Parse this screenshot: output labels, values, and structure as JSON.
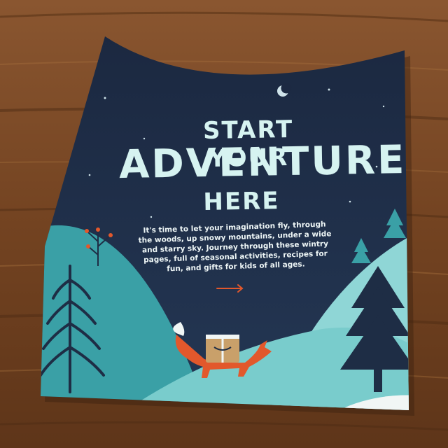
{
  "flyer": {
    "headline_line1": "START YOUR",
    "headline_line2": "ADVENTURE",
    "headline_line3": "HERE",
    "body": "It's time to let your imagination fly, through the woods, up snowy mountains, under a wide and starry sky. Journey through these wintry pages, full of seasonal activities, recipes for fun, and gifts for kids of all ages."
  },
  "colors": {
    "table_wood": "#7a4a26",
    "night_sky": "#1e2d45",
    "hill_teal": "#3aa0a6",
    "hill_light": "#8fd6d6",
    "snow": "#f1f6f5",
    "fox_orange": "#e2582c",
    "headline_mint": "#d6f3f1"
  },
  "icons": {
    "moon": "crescent-moon-icon",
    "arrow": "right-arrow-icon",
    "fox": "fox-with-package-illustration"
  }
}
